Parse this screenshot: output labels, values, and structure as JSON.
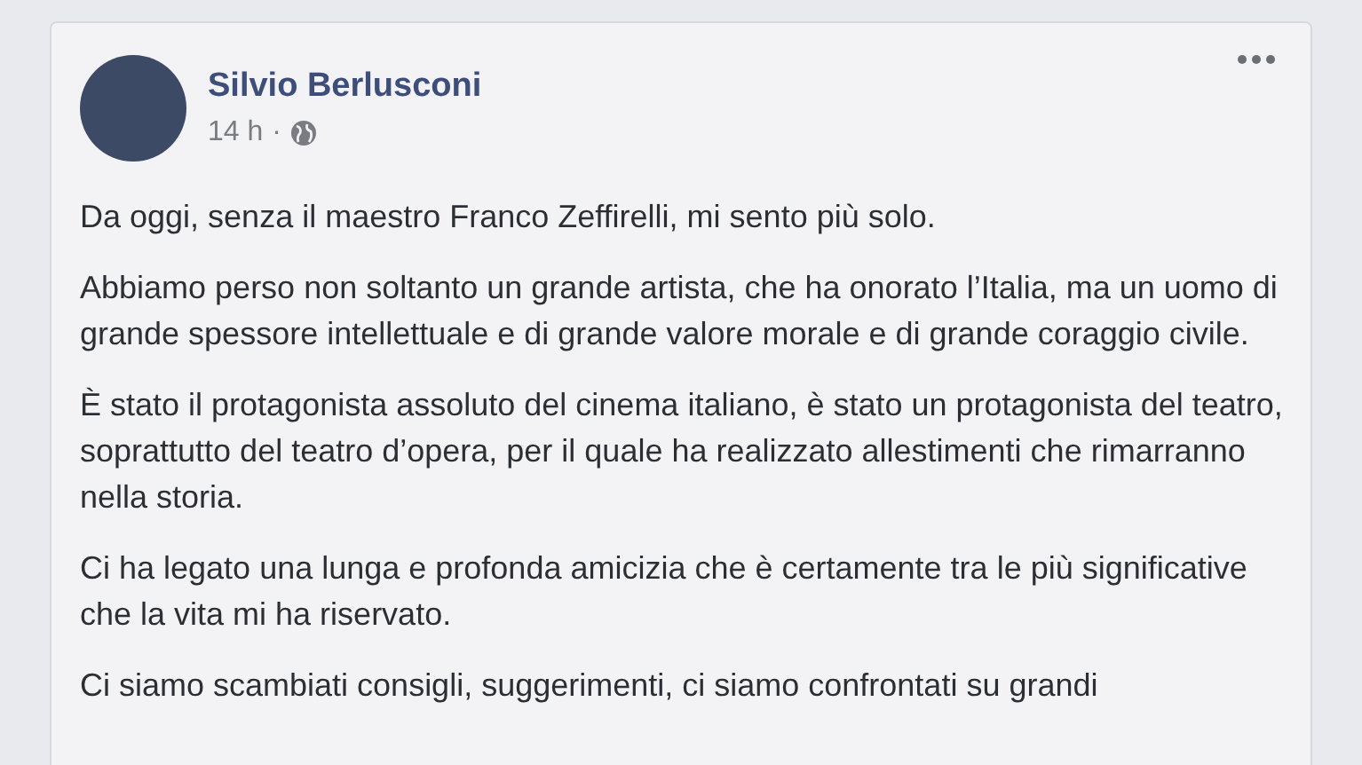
{
  "post": {
    "author": "Silvio Berlusconi",
    "time": "14 h",
    "separator": "·",
    "paragraphs": [
      "Da oggi, senza il maestro Franco Zeffirelli, mi sento più solo.",
      "Abbiamo perso non soltanto un grande artista, che ha onorato l’Italia, ma un uomo di grande spessore intellettuale e di grande valore morale e di grande coraggio civile.",
      "È stato il protagonista assoluto del cinema italiano, è stato un protagonista del teatro, soprattutto del teatro d’opera, per il quale ha realizzato allestimenti che rimarranno nella storia.",
      "Ci ha legato una lunga e profonda amicizia che è certamente tra le più significative che la vita mi ha riservato.",
      "Ci siamo scambiati consigli, suggerimenti, ci siamo confrontati su grandi"
    ]
  }
}
